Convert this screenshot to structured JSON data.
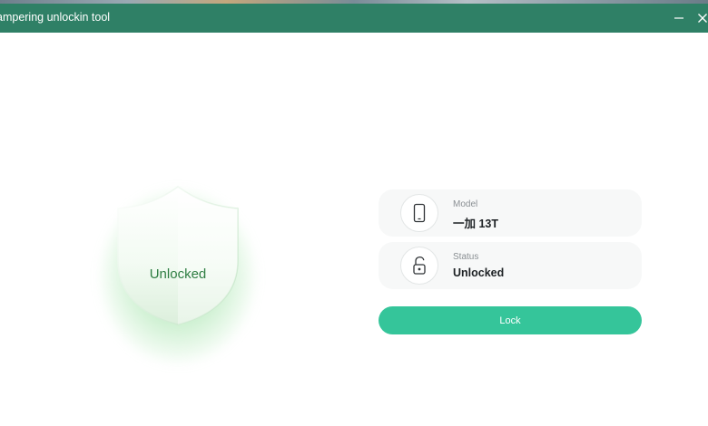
{
  "window": {
    "title": "ampering unlockin tool"
  },
  "shield": {
    "label": "Unlocked"
  },
  "device": {
    "model_label": "Model",
    "model_value": "一加 13T",
    "status_label": "Status",
    "status_value": "Unlocked"
  },
  "actions": {
    "lock_label": "Lock"
  },
  "colors": {
    "titlebar": "#2f8066",
    "accent": "#35c59a",
    "shield_text": "#2e7d42",
    "glow": "#5ccd6e"
  },
  "icons": {
    "minimize": "minimize-icon",
    "close": "close-icon",
    "shield": "shield-icon",
    "model": "phone-icon",
    "status": "unlocked-padlock-icon"
  }
}
